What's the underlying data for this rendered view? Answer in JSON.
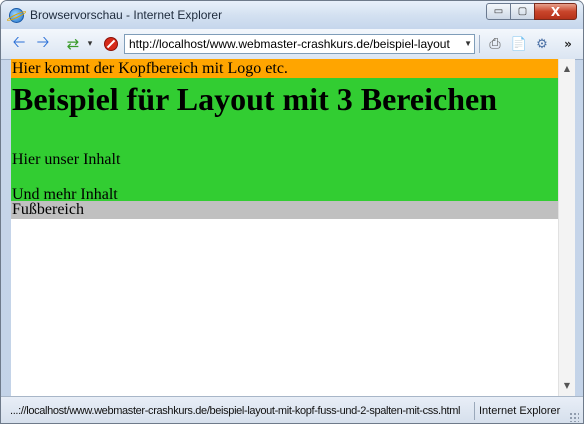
{
  "window": {
    "title": "Browservorschau - Internet Explorer",
    "controls": {
      "minimize": "▭",
      "maximize": "▢",
      "close": "X"
    }
  },
  "toolbar": {
    "address": "http://localhost/www.webmaster-crashkurs.de/beispiel-layout",
    "more": "»",
    "icons": [
      "back-arrow-icon",
      "forward-arrow-icon",
      "refresh-icon",
      "stop-icon",
      "print-icon",
      "page-icon",
      "tools-icon"
    ]
  },
  "page": {
    "header_text": "Hier kommt der Kopfbereich mit Logo etc.",
    "heading": "Beispiel für Layout mit 3 Bereichen",
    "paragraphs": [
      "Hier unser Inhalt",
      "Und mehr Inhalt"
    ],
    "footer_text": "Fußbereich"
  },
  "colors": {
    "header_bg": "#ffa500",
    "main_bg": "#32cd32",
    "footer_bg": "#c0c0c0"
  },
  "statusbar": {
    "url": "...://localhost/www.webmaster-crashkurs.de/beispiel-layout-mit-kopf-fuss-und-2-spalten-mit-css.html",
    "zone": "Internet Explorer"
  }
}
